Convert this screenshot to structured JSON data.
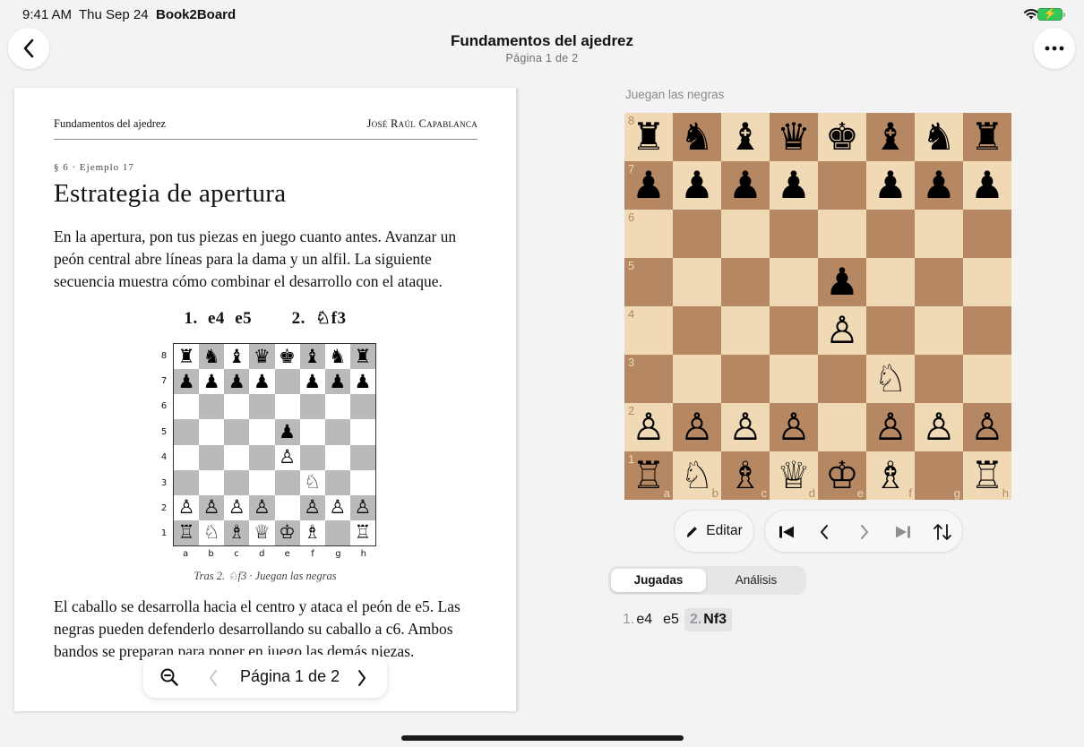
{
  "status_bar": {
    "time": "9:41 AM",
    "date": "Thu Sep 24",
    "app_name": "Book2Board",
    "battery": "⚡"
  },
  "nav": {
    "title": "Fundamentos del ajedrez",
    "subtitle": "Página 1 de 2",
    "back_icon": "chevron-left-icon",
    "more_icon": "ellipsis-icon"
  },
  "book_page": {
    "running_head_left": "Fundamentos del ajedrez",
    "running_head_right": "José Raúl Capablanca",
    "section_label": "§ 6 · Ejemplo 17",
    "chapter_title": "Estrategia de apertura",
    "paragraph1": "En la apertura, pon tus piezas en juego cuanto antes. Avanzar un peón central abre líneas para la dama y un alfil. La siguiente secuencia muestra cómo combinar el desarrollo con el ataque.",
    "moves": {
      "num1": "1.",
      "m1w": "e4",
      "m1b": "e5",
      "num2": "2.",
      "m2w": "♘f3"
    },
    "diagram_ranks": [
      "8",
      "7",
      "6",
      "5",
      "4",
      "3",
      "2",
      "1"
    ],
    "diagram_files": [
      "a",
      "b",
      "c",
      "d",
      "e",
      "f",
      "g",
      "h"
    ],
    "caption": "Tras 2. ♘f3 · Juegan las negras",
    "paragraph2": "El caballo se desarrolla hacia el centro y ataca el peón de e5. Las negras pueden defenderlo desarrollando su caballo a c6. Ambos bandos se preparan para poner en juego las demás piezas."
  },
  "pager": {
    "label": "Página 1 de 2",
    "zoom_icon": "zoom-out-icon",
    "prev_icon": "chevron-left-icon",
    "next_icon": "chevron-right-icon"
  },
  "board_panel": {
    "turn_label": "Juegan las negras",
    "position_fen": "rnbqkbnr/pppp1ppp/8/4p3/4P3/5N2/PPPP1PPP/RNBQKB1R b KQkq - 1 2",
    "ranks": [
      "8",
      "7",
      "6",
      "5",
      "4",
      "3",
      "2",
      "1"
    ],
    "files": [
      "a",
      "b",
      "c",
      "d",
      "e",
      "f",
      "g",
      "h"
    ],
    "light_color": "#f0dab5",
    "dark_color": "#b58863"
  },
  "controls": {
    "edit_label": "Editar",
    "edit_icon": "pencil-icon",
    "first_icon": "skip-to-start-icon",
    "prev_icon": "chevron-left-icon",
    "next_icon": "chevron-right-icon",
    "last_icon": "skip-to-end-icon",
    "flip_icon": "flip-board-icon"
  },
  "tabs": {
    "moves": "Jugadas",
    "analysis": "Análisis",
    "selected": "Jugadas"
  },
  "movelist": [
    {
      "num": "1.",
      "san": "e4"
    },
    {
      "num": "",
      "san": "e5"
    },
    {
      "num": "2.",
      "san": "Nf3",
      "current": true
    }
  ]
}
